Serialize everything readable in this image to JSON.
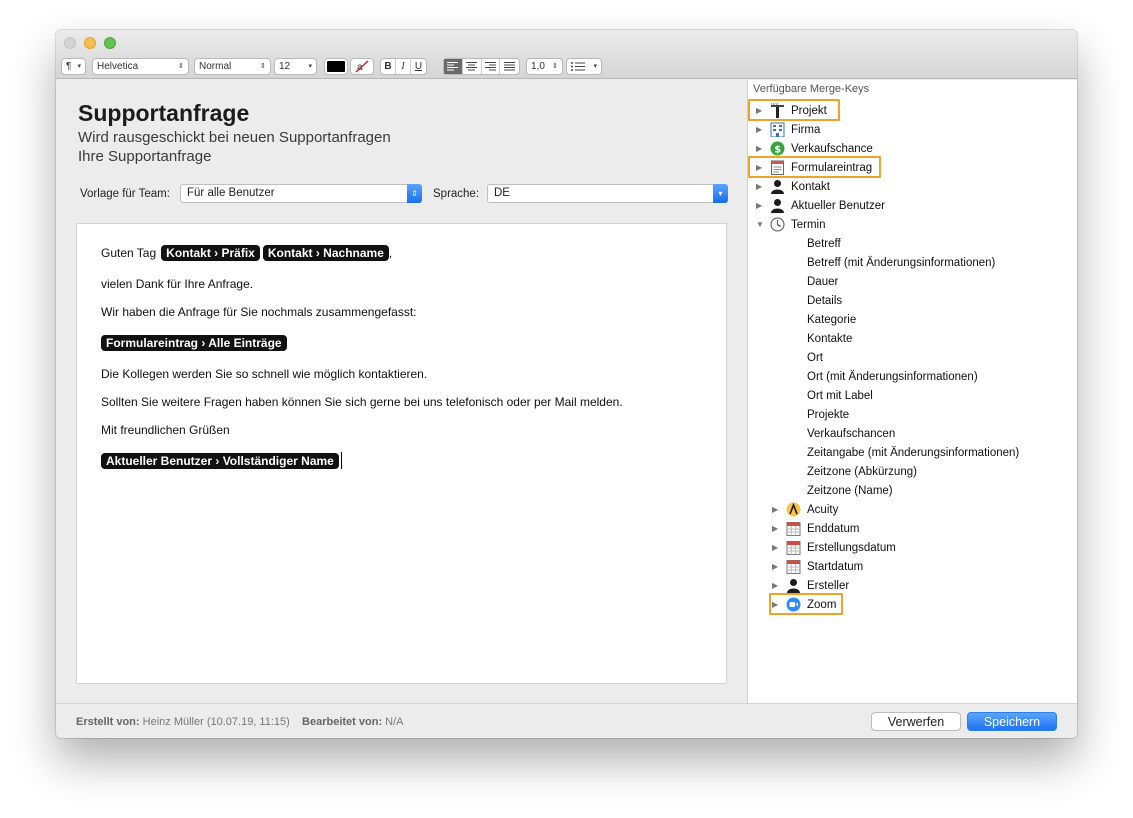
{
  "toolbar": {
    "paragraph_symbol": "¶",
    "font_family": "Helvetica",
    "font_style": "Normal",
    "font_size": "12",
    "bold": "B",
    "italic": "I",
    "underline": "U",
    "line_spacing": "1,0",
    "text_color": "#000000"
  },
  "editor": {
    "title": "Supportanfrage",
    "subtitle1": "Wird rausgeschickt bei neuen Supportanfragen",
    "subtitle2": "Ihre Supportanfrage",
    "team_label": "Vorlage für Team:",
    "team_value": "Für alle Benutzer",
    "language_label": "Sprache:",
    "language_value": "DE"
  },
  "document": {
    "greeting": "Guten Tag",
    "tag_prefix": "Kontakt › Präfix",
    "tag_lastname": "Kontakt › Nachname",
    "comma": ",",
    "line2": "vielen Dank für Ihre Anfrage.",
    "line3": "Wir haben die Anfrage für Sie nochmals zusammengefasst:",
    "tag_form": "Formulareintrag › Alle Einträge",
    "line5": "Die Kollegen werden Sie so schnell wie möglich kontaktieren.",
    "line6": "Sollten Sie weitere Fragen haben können Sie sich gerne bei uns telefonisch oder per Mail melden.",
    "line7": "Mit freundlichen Grüßen",
    "tag_user": "Aktueller Benutzer › Vollständiger Name"
  },
  "panel": {
    "header": "Verfügbare Merge-Keys",
    "top_items": [
      {
        "label": "Projekt",
        "icon": "project-icon",
        "highlighted": true
      },
      {
        "label": "Firma",
        "icon": "building-icon",
        "highlighted": false
      },
      {
        "label": "Verkaufschance",
        "icon": "dollar-icon",
        "highlighted": false
      },
      {
        "label": "Formulareintrag",
        "icon": "form-icon",
        "highlighted": true
      },
      {
        "label": "Kontakt",
        "icon": "person-icon",
        "highlighted": false
      },
      {
        "label": "Aktueller Benutzer",
        "icon": "person-icon",
        "highlighted": false
      },
      {
        "label": "Termin",
        "icon": "clock-icon",
        "expanded": true
      }
    ],
    "termin_children": [
      "Betreff",
      "Betreff (mit Änderungsinformationen)",
      "Dauer",
      "Details",
      "Kategorie",
      "Kontakte",
      "Ort",
      "Ort (mit Änderungsinformationen)",
      "Ort mit Label",
      "Projekte",
      "Verkaufschancen",
      "Zeitangabe (mit Änderungsinformationen)",
      "Zeitzone (Abkürzung)",
      "Zeitzone (Name)"
    ],
    "termin_subgroups": [
      {
        "label": "Acuity",
        "icon": "acuity-icon"
      },
      {
        "label": "Enddatum",
        "icon": "calendar-icon"
      },
      {
        "label": "Erstellungsdatum",
        "icon": "calendar-icon"
      },
      {
        "label": "Startdatum",
        "icon": "calendar-icon"
      },
      {
        "label": "Ersteller",
        "icon": "person-icon"
      },
      {
        "label": "Zoom",
        "icon": "zoom-icon",
        "highlighted": true
      }
    ]
  },
  "footer": {
    "created_label": "Erstellt von:",
    "created_value": "Heinz Müller (10.07.19, 11:15)",
    "edited_label": "Bearbeitet von:",
    "edited_value": "N/A",
    "discard": "Verwerfen",
    "save": "Speichern"
  },
  "colors": {
    "accent": "#1c74f4",
    "highlight": "#f1a22b",
    "tag_bg": "#111111"
  }
}
